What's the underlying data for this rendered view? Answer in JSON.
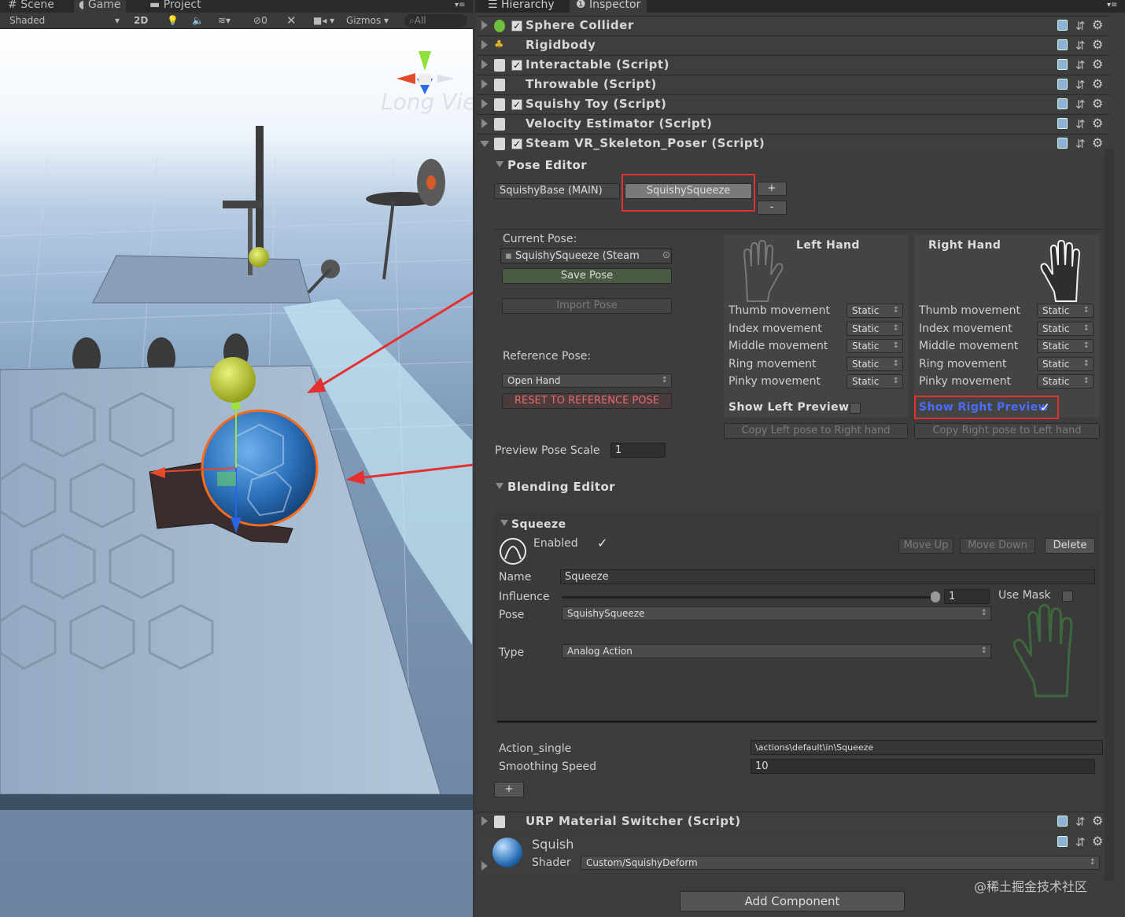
{
  "scene_tabs": {
    "scene": "Scene",
    "game": "Game",
    "project": "Project"
  },
  "scene_toolbar": {
    "shading": "Shaded",
    "mode_2d": "2D",
    "hidden_count": "0",
    "gizmos": "Gizmos",
    "search_placeholder": "All",
    "persp_label": "Long View"
  },
  "right_tabs": {
    "hierarchy": "Hierarchy",
    "inspector": "Inspector"
  },
  "components": [
    {
      "title": "Sphere Collider",
      "checked": true,
      "icon": "sphere-collider-icon"
    },
    {
      "title": "Rigidbody",
      "checked": false,
      "icon": "rigidbody-icon"
    },
    {
      "title": "Interactable (Script)",
      "checked": true,
      "icon": "script-icon"
    },
    {
      "title": "Throwable (Script)",
      "checked": false,
      "icon": "script-icon"
    },
    {
      "title": "Squishy Toy (Script)",
      "checked": true,
      "icon": "script-icon"
    },
    {
      "title": "Velocity Estimator (Script)",
      "checked": false,
      "icon": "script-icon"
    },
    {
      "title": "Steam VR_Skeleton_Poser (Script)",
      "checked": true,
      "icon": "script-icon"
    }
  ],
  "pose_editor": {
    "title": "Pose Editor",
    "tabs": [
      "SquishyBase (MAIN)",
      "SquishySqueeze"
    ],
    "add_label": "+",
    "remove_label": "-",
    "current_pose_label": "Current Pose:",
    "current_pose_value": "SquishySqueeze (Steam",
    "save_pose": "Save Pose",
    "import_pose": "Import Pose",
    "reference_pose_label": "Reference Pose:",
    "reference_pose_value": "Open Hand",
    "reset_button": "RESET TO REFERENCE POSE",
    "left_hand": {
      "title": "Left Hand",
      "rows": [
        {
          "label": "Thumb movement",
          "value": "Static"
        },
        {
          "label": "Index movement",
          "value": "Static"
        },
        {
          "label": "Middle movement",
          "value": "Static"
        },
        {
          "label": "Ring movement",
          "value": "Static"
        },
        {
          "label": "Pinky movement",
          "value": "Static"
        }
      ],
      "show_preview": "Show Left Preview",
      "copy_button": "Copy Left pose to Right hand"
    },
    "right_hand": {
      "title": "Right Hand",
      "rows": [
        {
          "label": "Thumb movement",
          "value": "Static"
        },
        {
          "label": "Index movement",
          "value": "Static"
        },
        {
          "label": "Middle movement",
          "value": "Static"
        },
        {
          "label": "Ring movement",
          "value": "Static"
        },
        {
          "label": "Pinky movement",
          "value": "Static"
        }
      ],
      "show_preview": "Show Right Preview",
      "copy_button": "Copy Right pose to Left hand"
    },
    "preview_scale_label": "Preview Pose Scale",
    "preview_scale_value": "1"
  },
  "blending_editor": {
    "title": "Blending Editor",
    "blend_name": "Squeeze",
    "enabled_label": "Enabled",
    "move_up": "Move Up",
    "move_down": "Move Down",
    "delete": "Delete",
    "name_label": "Name",
    "name_value": "Squeeze",
    "influence_label": "Influence",
    "influence_value": "1",
    "use_mask_label": "Use Mask",
    "pose_label": "Pose",
    "pose_value": "SquishySqueeze",
    "type_label": "Type",
    "type_value": "Analog Action",
    "action_label": "Action_single",
    "action_value": "\\actions\\default\\in\\Squeeze",
    "smoothing_label": "Smoothing Speed",
    "smoothing_value": "10",
    "add_label": "+"
  },
  "urp_switcher": {
    "title": "URP Material Switcher (Script)"
  },
  "material": {
    "name": "Squish",
    "shader_label": "Shader",
    "shader_value": "Custom/SquishyDeform"
  },
  "add_component": "Add Component",
  "watermark": "@稀土掘金技术社区",
  "colors": {
    "annotation_red": "#e53030",
    "preview_blue": "#4a6cff",
    "ball_blue": "#2a6fb8",
    "selection_orange": "#ff6a1a",
    "hand_green": "#3f7a3f"
  }
}
